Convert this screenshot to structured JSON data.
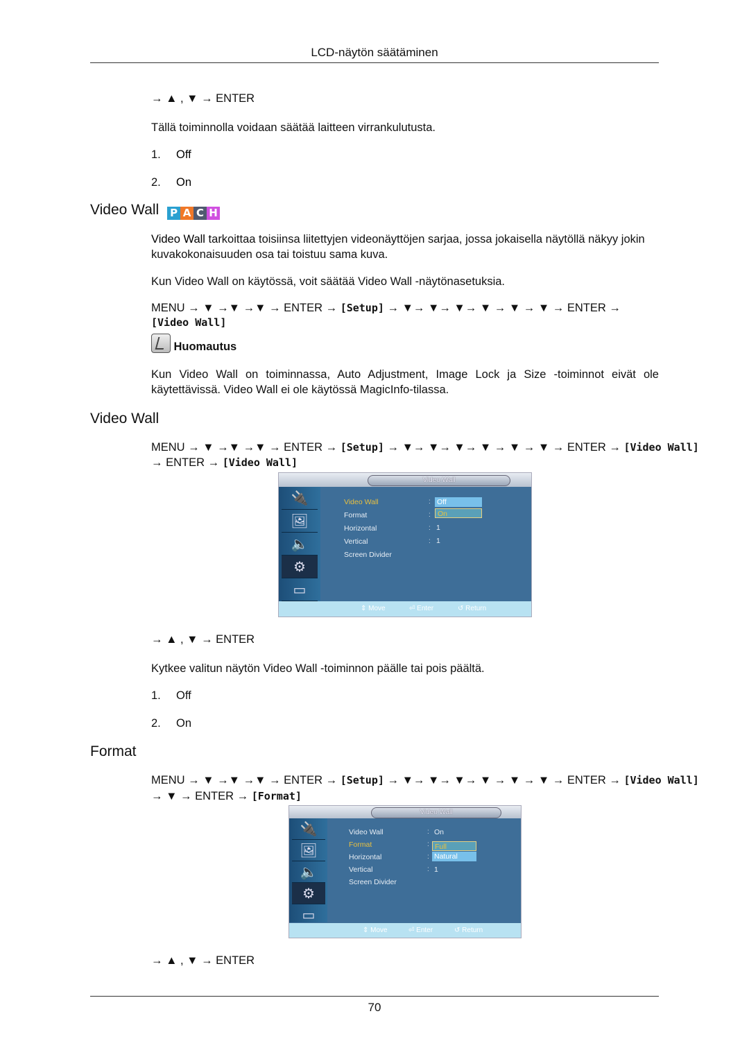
{
  "header": {
    "title": "LCD-näytön säätäminen"
  },
  "page_number": "70",
  "intro": {
    "nav_arrow": "→ ▲ , ▼ → ENTER",
    "description": "Tällä toiminnolla voidaan säätää laitteen virrankulutusta.",
    "options": [
      {
        "num": "1.",
        "label": "Off"
      },
      {
        "num": "2.",
        "label": "On"
      }
    ]
  },
  "section_videowall_intro": {
    "title": "Video Wall",
    "badge": [
      {
        "letter": "P",
        "color": "#2aa0d0"
      },
      {
        "letter": "A",
        "color": "#f07828"
      },
      {
        "letter": "C",
        "color": "#505a70"
      },
      {
        "letter": "H",
        "color": "#d050e0"
      }
    ],
    "para1_bold": "Video Wall",
    "para1_rest": " tarkoittaa toisiinsa liitettyjen videonäyttöjen sarjaa, jossa jokaisella näytöllä näkyy jokin kuvakokonaisuuden osa tai toistuu sama kuva.",
    "para2": [
      "Kun ",
      "Video Wall",
      " on käytössä, voit säätää ",
      "Video Wall",
      " -näytönasetuksia."
    ],
    "nav_line1": "MENU → ▼ →▼ →▼ → ENTER →",
    "nav_setup": "[Setup]",
    "nav_line1b": "→ ▼→ ▼→ ▼→ ▼ → ▼ → ▼ → ENTER →",
    "nav_target": "[Video Wall]",
    "note_label": "Huomautus",
    "note_text": [
      "Kun ",
      "Video Wall",
      " on toiminnassa, ",
      "Auto Adjustment",
      ", ",
      "Image Lock",
      " ja ",
      "Size",
      " -toiminnot eivät ole käytettävissä. ",
      "Video Wall",
      " ei ole käytössä ",
      "MagicInfo",
      "-tilassa."
    ]
  },
  "section_videowall": {
    "title": "Video Wall",
    "nav_a": "MENU → ▼ →▼ →▼ → ENTER →",
    "nav_setup": "[Setup]",
    "nav_b": "→ ▼→ ▼→ ▼→ ▼ → ▼ → ▼ → ENTER →",
    "nav_vw": "[Video Wall]",
    "nav_c": "→ ENTER →",
    "nav_target": "[Video Wall]",
    "osd": {
      "title": "Video Wall",
      "rows": [
        {
          "label": "Video Wall",
          "value": ""
        },
        {
          "label": "Format",
          "value": ""
        },
        {
          "label": "Horizontal",
          "value": "1"
        },
        {
          "label": "Vertical",
          "value": "1"
        },
        {
          "label": "Screen Divider",
          "value": ""
        }
      ],
      "dropdown": [
        {
          "label": "Off",
          "highlighted": false
        },
        {
          "label": "On",
          "highlighted": true
        }
      ],
      "footer": {
        "move": "⇕ Move",
        "enter": "⏎ Enter",
        "return": "↺ Return"
      }
    },
    "nav_arrow": "→ ▲ , ▼ → ENTER",
    "description": [
      "Kytkee valitun näytön ",
      "Video Wall",
      " -toiminnon päälle tai pois päältä."
    ],
    "options": [
      {
        "num": "1.",
        "label": "Off"
      },
      {
        "num": "2.",
        "label": "On"
      }
    ]
  },
  "section_format": {
    "title": "Format",
    "nav_a": "MENU → ▼ →▼ →▼ → ENTER →",
    "nav_setup": "[Setup]",
    "nav_b": "→ ▼→ ▼→ ▼→ ▼ → ▼ → ▼ → ENTER →",
    "nav_vw": "[Video Wall]",
    "nav_c": "→ ▼ → ENTER →",
    "nav_target": "[Format]",
    "osd": {
      "title": "Video Wall",
      "rows": [
        {
          "label": "Video Wall",
          "value": "On"
        },
        {
          "label": "Format",
          "value": ""
        },
        {
          "label": "Horizontal",
          "value": ""
        },
        {
          "label": "Vertical",
          "value": "1"
        },
        {
          "label": "Screen Divider",
          "value": ""
        }
      ],
      "dropdown": [
        {
          "label": "Full",
          "highlighted": true
        },
        {
          "label": "Natural",
          "highlighted": false
        }
      ],
      "footer": {
        "move": "⇕ Move",
        "enter": "⏎ Enter",
        "return": "↺ Return"
      }
    },
    "nav_arrow": "→ ▲ , ▼ → ENTER"
  }
}
